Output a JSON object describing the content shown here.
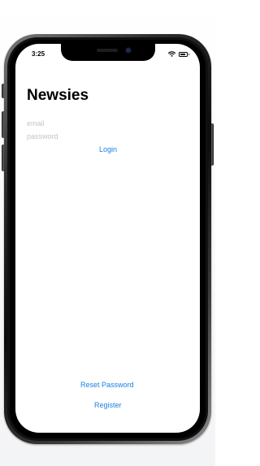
{
  "status_bar": {
    "time": "3:25",
    "wifi_icon": "wifi-icon",
    "battery_icon": "battery-icon"
  },
  "app": {
    "title": "Newsies",
    "email_placeholder": "email",
    "password_placeholder": "password",
    "login_label": "Login",
    "reset_password_label": "Reset Password",
    "register_label": "Register"
  },
  "colors": {
    "accent": "#1a7fe6",
    "placeholder": "#c4c4c6"
  }
}
